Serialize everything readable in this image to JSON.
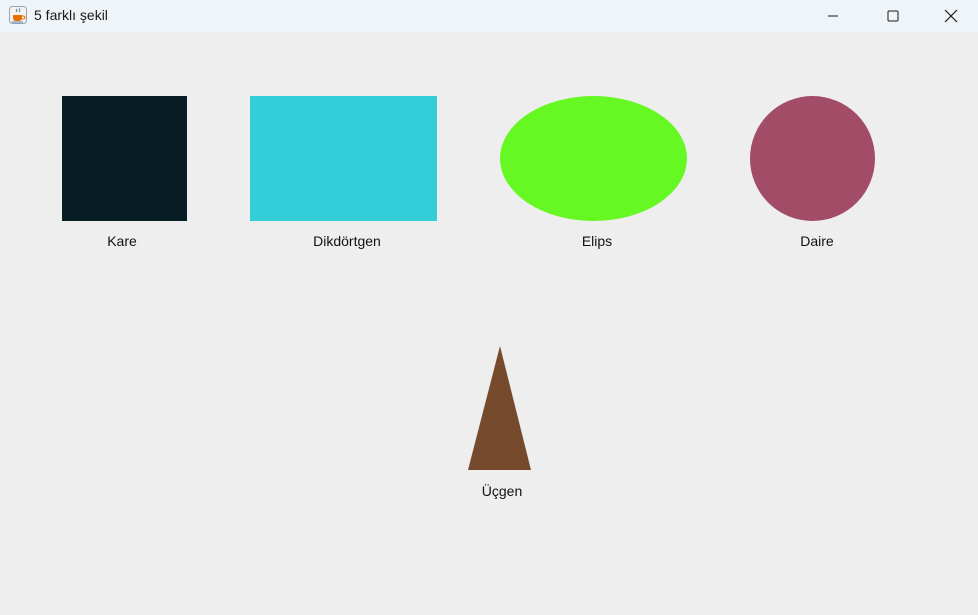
{
  "window": {
    "title": "5 farklı şekil",
    "app_icon": "java-cup-icon",
    "controls": {
      "minimize_icon": "minimize-icon",
      "maximize_icon": "maximize-icon",
      "close_icon": "close-icon"
    }
  },
  "shapes": {
    "square": {
      "label": "Kare",
      "color": "#061d24"
    },
    "rectangle": {
      "label": "Dikdörtgen",
      "color": "#33ced8"
    },
    "ellipse": {
      "label": "Elips",
      "color": "#65f823"
    },
    "circle": {
      "label": "Daire",
      "color": "#a34c68"
    },
    "triangle": {
      "label": "Üçgen",
      "color": "#764a2c"
    }
  }
}
